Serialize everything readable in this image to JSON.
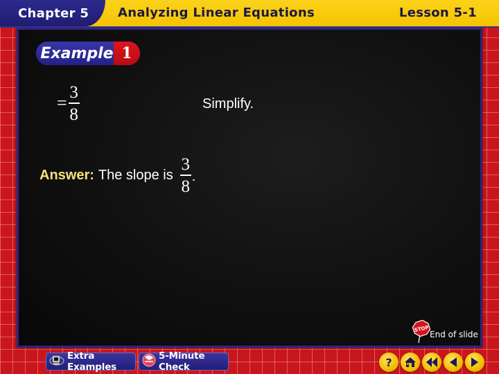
{
  "header": {
    "chapter": "Chapter 5",
    "title": "Analyzing Linear Equations",
    "lesson": "Lesson 5-1"
  },
  "example": {
    "word": "Example",
    "number": "1"
  },
  "content": {
    "equation": {
      "sign": "=",
      "numerator": "3",
      "denominator": "8"
    },
    "step_note": "Simplify.",
    "answer": {
      "label": "Answer:",
      "text": "The slope is",
      "numerator": "3",
      "denominator": "8",
      "trailing": "."
    }
  },
  "end_of_slide": {
    "icon": "stop-sign-icon",
    "label": "End of slide"
  },
  "footer": {
    "extra_examples": {
      "label": "Extra Examples",
      "icon": "computer-icon"
    },
    "five_minute_check": {
      "label": "5-Minute Check",
      "icon": "timer-icon"
    },
    "nav": [
      {
        "name": "help",
        "icon": "question-icon"
      },
      {
        "name": "home",
        "icon": "home-icon"
      },
      {
        "name": "first",
        "icon": "rewind-icon"
      },
      {
        "name": "previous",
        "icon": "arrow-left-icon"
      },
      {
        "name": "next",
        "icon": "arrow-right-icon"
      }
    ]
  },
  "colors": {
    "header_yellow": "#f5c400",
    "chapter_blue": "#25218a",
    "frame_red": "#c8161c",
    "answer_yellow": "#f6e27a",
    "example_red": "#c8101a"
  }
}
